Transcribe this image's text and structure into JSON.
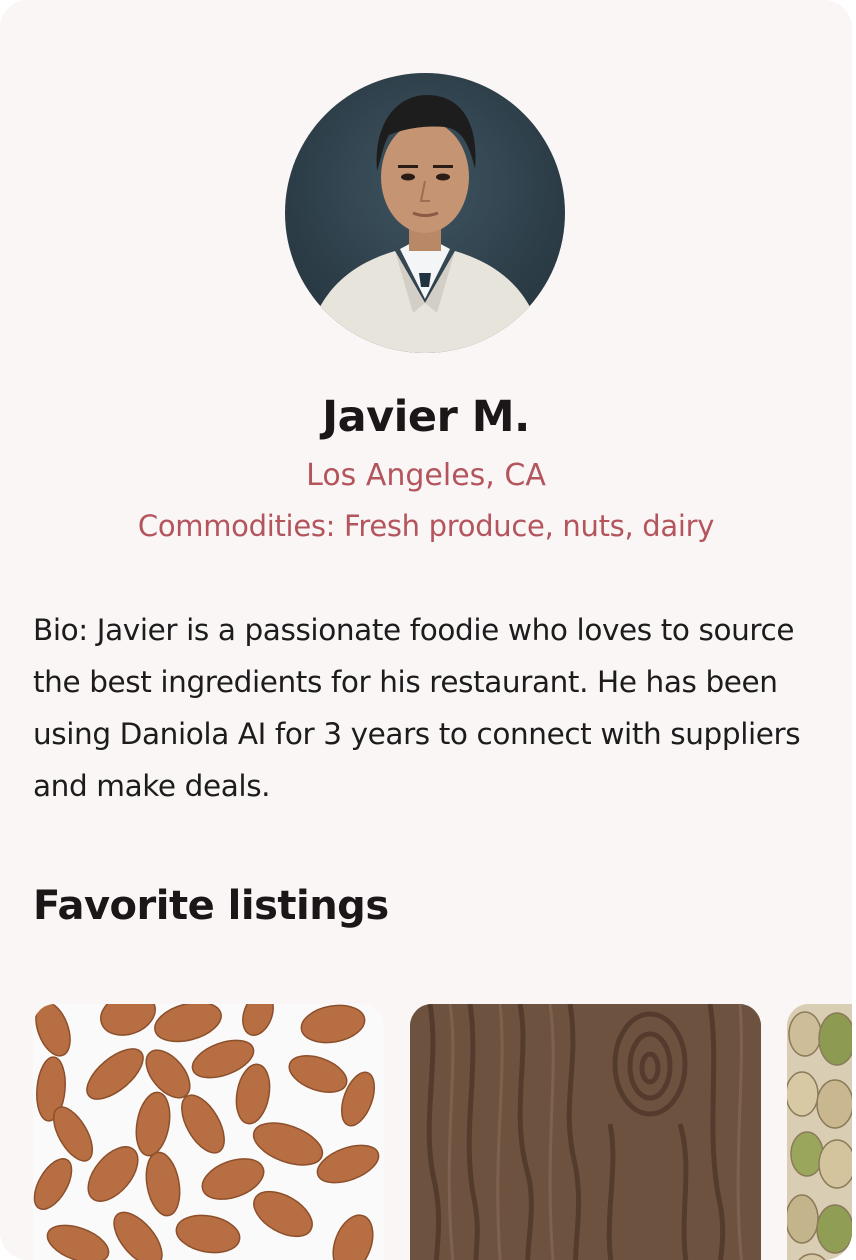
{
  "profile": {
    "name": "Javier M.",
    "location": "Los Angeles, CA",
    "commodities": "Commodities: Fresh produce, nuts, dairy",
    "bio": "Bio: Javier is a passionate foodie who loves to source the best ingredients for his restaurant. He has been using Daniola AI for 3 years to connect with suppliers and make deals."
  },
  "favorites": {
    "title": "Favorite listings",
    "listings": [
      {
        "image": "almonds"
      },
      {
        "image": "walnut-wood"
      },
      {
        "image": "pistachios"
      }
    ]
  },
  "colors": {
    "card_background": "#f9f6f5",
    "accent": "#b4555e",
    "text": "#1b1617"
  }
}
